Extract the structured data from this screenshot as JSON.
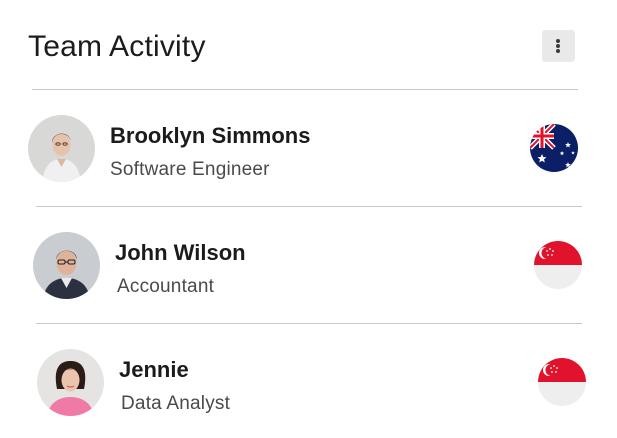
{
  "header": {
    "title": "Team Activity",
    "menu_icon": "more-vertical-icon"
  },
  "members": [
    {
      "name": "Brooklyn Simmons",
      "role": "Software Engineer",
      "flag": "australia-flag-icon"
    },
    {
      "name": "John Wilson",
      "role": "Accountant",
      "flag": "singapore-flag-icon"
    },
    {
      "name": "Jennie",
      "role": "Data Analyst",
      "flag": "singapore-flag-icon"
    }
  ],
  "colors": {
    "divider": "#c9c9c9",
    "menu_bg": "#e9e9ea",
    "flag_red": "#e0122c",
    "flag_navy": "#0a1f66"
  }
}
